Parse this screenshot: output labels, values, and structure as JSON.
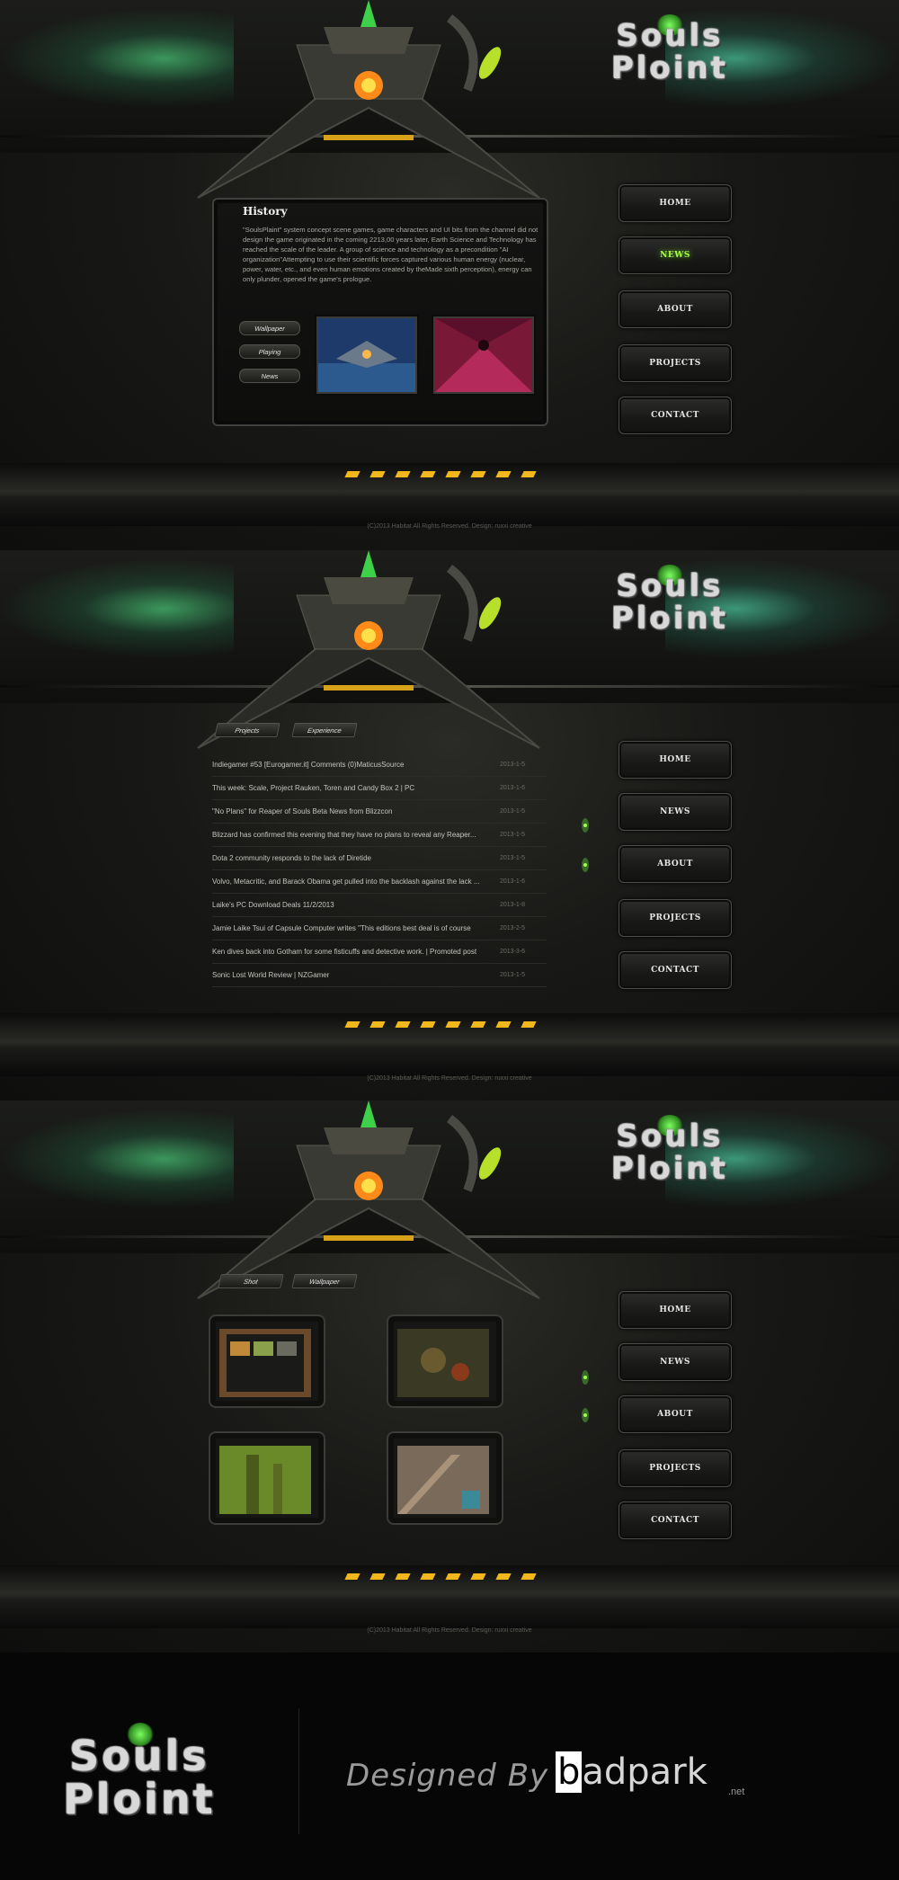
{
  "brand": {
    "logo_line1": "Souls",
    "logo_line2": "Ploint"
  },
  "colors": {
    "accent_green": "#a6ff45",
    "hazard_yellow": "#f2b71c",
    "background": "#0b0b0a"
  },
  "nav": {
    "items": [
      "HOME",
      "NEWS",
      "ABOUT",
      "PROJECTS",
      "CONTACT"
    ],
    "active_index_page1": 1
  },
  "page1": {
    "panel_title": "History",
    "panel_text": "\"SoulsPlaint\" system concept scene games, game characters and UI bits from the channel did not design the game originated in the coming 2213,00 years later, Earth Science and Technology has reached the scale of the leader. A group of science and technology as a precondition \"AI organization\"Attempting to use their scientific forces captured various human energy (nuclear, power, water, etc., and even human emotions created by theMade sixth perception), energy can only plunder, opened the game's prologue.",
    "buttons": [
      "Wallpaper",
      "Playing",
      "News"
    ],
    "copyright": "(C)2013 Habitat All Rights Reserved.  Design: ruxxi creative"
  },
  "page2": {
    "tabs": [
      "Projects",
      "Experience"
    ],
    "news": [
      {
        "title": "Indiegamer #53 [Eurogamer.it] Comments (0)MaticusSource",
        "date": "2013-1-5"
      },
      {
        "title": "This week: Scale, Project Rauken, Toren and Candy Box 2 | PC",
        "date": "2013-1-6"
      },
      {
        "title": "\"No Plans\" for Reaper of Souls Beta News from Blizzcon",
        "date": "2013-1-5"
      },
      {
        "title": "Blizzard has confirmed this evening that they have no plans to reveal any Reaper...",
        "date": "2013-1-5"
      },
      {
        "title": "Dota 2 community responds to the lack of Diretide",
        "date": "2013-1-5"
      },
      {
        "title": "Volvo, Metacritic, and Barack Obama get pulled into the backlash against the lack ...",
        "date": "2013-1-6"
      },
      {
        "title": "Laike's PC Download Deals 11/2/2013",
        "date": "2013-1-8"
      },
      {
        "title": "Jamie Laike Tsui of Capsule Computer writes \"This editions best deal is of course",
        "date": "2013-2-5"
      },
      {
        "title": "Ken dives back into Gotham for some fisticuffs and detective work. | Promoted post",
        "date": "2013-3-6"
      },
      {
        "title": "Sonic Lost World Review | NZGamer",
        "date": "2013-1-5"
      }
    ],
    "copyright": "(C)2013 Habitat All Rights Reserved.  Design: ruxxi creative"
  },
  "page3": {
    "tabs": [
      "Shot",
      "Wallpaper"
    ],
    "copyright": "(C)2013 Habitat All Rights Reserved.  Design: ruxxi creative"
  },
  "credits": {
    "designed_by": "Designed  By",
    "brand_b": "b",
    "brand_rest": "adpark",
    "brand_suffix": ".net"
  }
}
